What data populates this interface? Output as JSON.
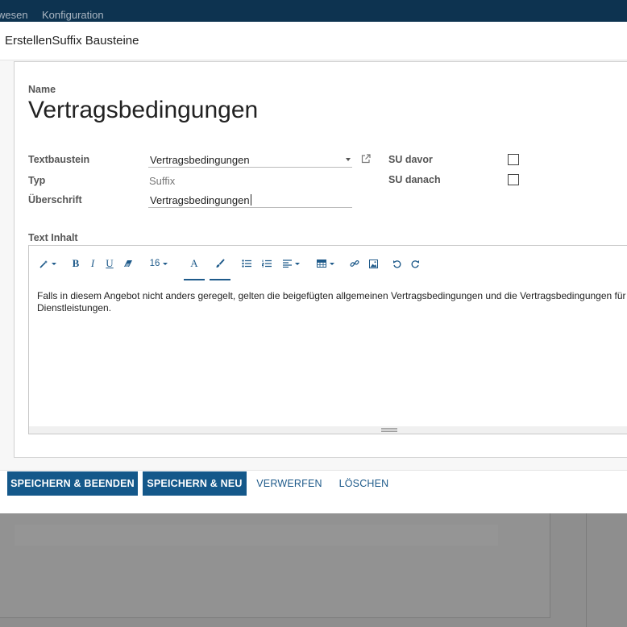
{
  "topbar": {
    "menu": [
      {
        "label": "wesen"
      },
      {
        "label": "Konfiguration"
      }
    ]
  },
  "dialog": {
    "title": "ErstellenSuffix Bausteine"
  },
  "form": {
    "name_label": "Name",
    "name_value": "Vertragsbedingungen",
    "textbaustein_label": "Textbaustein",
    "textbaustein_value": "Vertragsbedingungen",
    "typ_label": "Typ",
    "typ_value": "Suffix",
    "ueberschrift_label": "Überschrift",
    "ueberschrift_value": "Vertragsbedingungen",
    "su_davor_label": "SU davor",
    "su_davor_checked": false,
    "su_danach_label": "SU danach",
    "su_danach_checked": false,
    "text_inhalt_label": "Text Inhalt"
  },
  "editor": {
    "font_size": "16",
    "text_line1": "Falls in diesem Angebot nicht anders geregelt, gelten die beigefügten allgemeinen Vertragsbedingungen und die Vertragsbedingungen für",
    "text_line2": "Dienstleistungen.",
    "icons": [
      "magic-wand-icon",
      "bold-icon",
      "italic-icon",
      "underline-icon",
      "eraser-icon",
      "font-color-icon",
      "paint-brush-icon",
      "unordered-list-icon",
      "ordered-list-icon",
      "align-icon",
      "table-icon",
      "link-icon",
      "image-icon",
      "undo-icon",
      "redo-icon"
    ]
  },
  "footer": {
    "save_close": "SPEICHERN & BEENDEN",
    "save_new": "SPEICHERN & NEU",
    "discard": "VERWERFEN",
    "delete": "LÖSCHEN"
  },
  "colors": {
    "topbar": "#0d3350",
    "primary": "#14588a",
    "link": "#1e5a8a"
  }
}
